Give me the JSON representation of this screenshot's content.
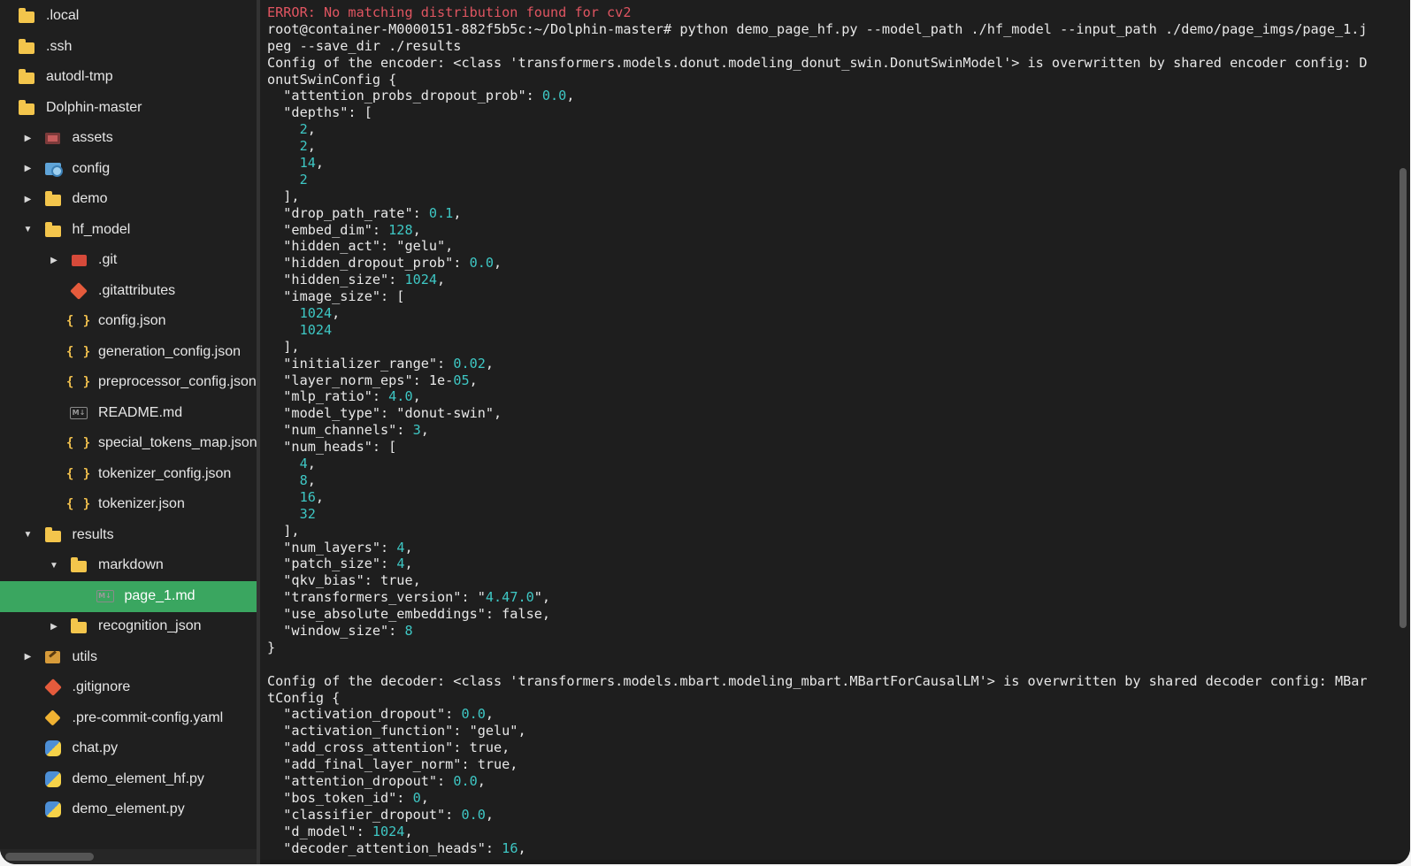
{
  "sidebar": {
    "items": [
      {
        "label": ".local",
        "icon": "folder-icon",
        "twisty": "none",
        "indent": 0
      },
      {
        "label": ".ssh",
        "icon": "folder-icon",
        "twisty": "none",
        "indent": 0
      },
      {
        "label": "autodl-tmp",
        "icon": "folder-icon",
        "twisty": "none",
        "indent": 0
      },
      {
        "label": "Dolphin-master",
        "icon": "folder-icon",
        "twisty": "none",
        "indent": 0
      },
      {
        "label": "assets",
        "icon": "assets-folder-icon",
        "twisty": "collapsed",
        "indent": 1
      },
      {
        "label": "config",
        "icon": "config-folder-icon",
        "twisty": "collapsed",
        "indent": 1
      },
      {
        "label": "demo",
        "icon": "folder-icon",
        "twisty": "collapsed",
        "indent": 1
      },
      {
        "label": "hf_model",
        "icon": "folder-icon",
        "twisty": "expanded",
        "indent": 1
      },
      {
        "label": ".git",
        "icon": "git-folder-icon",
        "twisty": "collapsed",
        "indent": 2
      },
      {
        "label": ".gitattributes",
        "icon": "git-icon",
        "twisty": "none",
        "indent": 2
      },
      {
        "label": "config.json",
        "icon": "json-icon",
        "twisty": "none",
        "indent": 2
      },
      {
        "label": "generation_config.json",
        "icon": "json-icon",
        "twisty": "none",
        "indent": 2
      },
      {
        "label": "preprocessor_config.json",
        "icon": "json-icon",
        "twisty": "none",
        "indent": 2
      },
      {
        "label": "README.md",
        "icon": "markdown-icon",
        "twisty": "none",
        "indent": 2
      },
      {
        "label": "special_tokens_map.json",
        "icon": "json-icon",
        "twisty": "none",
        "indent": 2
      },
      {
        "label": "tokenizer_config.json",
        "icon": "json-icon",
        "twisty": "none",
        "indent": 2
      },
      {
        "label": "tokenizer.json",
        "icon": "json-icon",
        "twisty": "none",
        "indent": 2
      },
      {
        "label": "results",
        "icon": "folder-icon",
        "twisty": "expanded",
        "indent": 1
      },
      {
        "label": "markdown",
        "icon": "folder-icon",
        "twisty": "expanded",
        "indent": 2
      },
      {
        "label": "page_1.md",
        "icon": "markdown-icon",
        "twisty": "none",
        "indent": 3,
        "selected": true
      },
      {
        "label": "recognition_json",
        "icon": "folder-icon",
        "twisty": "collapsed",
        "indent": 2
      },
      {
        "label": "utils",
        "icon": "utils-folder-icon",
        "twisty": "collapsed",
        "indent": 1
      },
      {
        "label": ".gitignore",
        "icon": "git-icon",
        "twisty": "none",
        "indent": 1
      },
      {
        "label": ".pre-commit-config.yaml",
        "icon": "yaml-icon",
        "twisty": "none",
        "indent": 1
      },
      {
        "label": "chat.py",
        "icon": "python-icon",
        "twisty": "none",
        "indent": 1
      },
      {
        "label": "demo_element_hf.py",
        "icon": "python-icon",
        "twisty": "none",
        "indent": 1
      },
      {
        "label": "demo_element.py",
        "icon": "python-icon",
        "twisty": "none",
        "indent": 1
      }
    ]
  },
  "terminal": {
    "lines": [
      [
        [
          "ERROR: No matching distribution found for cv2",
          "err"
        ]
      ],
      [
        [
          "root@container-M0000151-882f5b5c:~/Dolphin-master# python demo_page_hf.py --model_path ./hf_model --input_path ./demo/page_imgs/page_1.j",
          ""
        ]
      ],
      [
        [
          "peg --save_dir ./results",
          ""
        ]
      ],
      [
        [
          "Config of the encoder: <class 'transformers.models.donut.modeling_donut_swin.DonutSwinModel'> is overwritten by shared encoder config: D",
          ""
        ]
      ],
      [
        [
          "onutSwinConfig {",
          ""
        ]
      ],
      [
        [
          "  \"attention_probs_dropout_prob\": ",
          ""
        ],
        [
          "0.0",
          "num"
        ],
        [
          ",",
          ""
        ]
      ],
      [
        [
          "  \"depths\": [",
          ""
        ]
      ],
      [
        [
          "    ",
          ""
        ],
        [
          "2",
          "num"
        ],
        [
          ",",
          ""
        ]
      ],
      [
        [
          "    ",
          ""
        ],
        [
          "2",
          "num"
        ],
        [
          ",",
          ""
        ]
      ],
      [
        [
          "    ",
          ""
        ],
        [
          "14",
          "num"
        ],
        [
          ",",
          ""
        ]
      ],
      [
        [
          "    ",
          ""
        ],
        [
          "2",
          "num"
        ]
      ],
      [
        [
          "  ],",
          ""
        ]
      ],
      [
        [
          "  \"drop_path_rate\": ",
          ""
        ],
        [
          "0.1",
          "num"
        ],
        [
          ",",
          ""
        ]
      ],
      [
        [
          "  \"embed_dim\": ",
          ""
        ],
        [
          "128",
          "num"
        ],
        [
          ",",
          ""
        ]
      ],
      [
        [
          "  \"hidden_act\": \"gelu\",",
          ""
        ]
      ],
      [
        [
          "  \"hidden_dropout_prob\": ",
          ""
        ],
        [
          "0.0",
          "num"
        ],
        [
          ",",
          ""
        ]
      ],
      [
        [
          "  \"hidden_size\": ",
          ""
        ],
        [
          "1024",
          "num"
        ],
        [
          ",",
          ""
        ]
      ],
      [
        [
          "  \"image_size\": [",
          ""
        ]
      ],
      [
        [
          "    ",
          ""
        ],
        [
          "1024",
          "num"
        ],
        [
          ",",
          ""
        ]
      ],
      [
        [
          "    ",
          ""
        ],
        [
          "1024",
          "num"
        ]
      ],
      [
        [
          "  ],",
          ""
        ]
      ],
      [
        [
          "  \"initializer_range\": ",
          ""
        ],
        [
          "0.02",
          "num"
        ],
        [
          ",",
          ""
        ]
      ],
      [
        [
          "  \"layer_norm_eps\": 1e-",
          ""
        ],
        [
          "05",
          "num"
        ],
        [
          ",",
          ""
        ]
      ],
      [
        [
          "  \"mlp_ratio\": ",
          ""
        ],
        [
          "4.0",
          "num"
        ],
        [
          ",",
          ""
        ]
      ],
      [
        [
          "  \"model_type\": \"donut-swin\",",
          ""
        ]
      ],
      [
        [
          "  \"num_channels\": ",
          ""
        ],
        [
          "3",
          "num"
        ],
        [
          ",",
          ""
        ]
      ],
      [
        [
          "  \"num_heads\": [",
          ""
        ]
      ],
      [
        [
          "    ",
          ""
        ],
        [
          "4",
          "num"
        ],
        [
          ",",
          ""
        ]
      ],
      [
        [
          "    ",
          ""
        ],
        [
          "8",
          "num"
        ],
        [
          ",",
          ""
        ]
      ],
      [
        [
          "    ",
          ""
        ],
        [
          "16",
          "num"
        ],
        [
          ",",
          ""
        ]
      ],
      [
        [
          "    ",
          ""
        ],
        [
          "32",
          "num"
        ]
      ],
      [
        [
          "  ],",
          ""
        ]
      ],
      [
        [
          "  \"num_layers\": ",
          ""
        ],
        [
          "4",
          "num"
        ],
        [
          ",",
          ""
        ]
      ],
      [
        [
          "  \"patch_size\": ",
          ""
        ],
        [
          "4",
          "num"
        ],
        [
          ",",
          ""
        ]
      ],
      [
        [
          "  \"qkv_bias\": true,",
          ""
        ]
      ],
      [
        [
          "  \"transformers_version\": \"",
          ""
        ],
        [
          "4.47.0",
          "num"
        ],
        [
          "\",",
          ""
        ]
      ],
      [
        [
          "  \"use_absolute_embeddings\": false,",
          ""
        ]
      ],
      [
        [
          "  \"window_size\": ",
          ""
        ],
        [
          "8",
          "num"
        ]
      ],
      [
        [
          "}",
          ""
        ]
      ],
      [
        [
          "",
          ""
        ]
      ],
      [
        [
          "Config of the decoder: <class 'transformers.models.mbart.modeling_mbart.MBartForCausalLM'> is overwritten by shared decoder config: MBar",
          ""
        ]
      ],
      [
        [
          "tConfig {",
          ""
        ]
      ],
      [
        [
          "  \"activation_dropout\": ",
          ""
        ],
        [
          "0.0",
          "num"
        ],
        [
          ",",
          ""
        ]
      ],
      [
        [
          "  \"activation_function\": \"gelu\",",
          ""
        ]
      ],
      [
        [
          "  \"add_cross_attention\": true,",
          ""
        ]
      ],
      [
        [
          "  \"add_final_layer_norm\": true,",
          ""
        ]
      ],
      [
        [
          "  \"attention_dropout\": ",
          ""
        ],
        [
          "0.0",
          "num"
        ],
        [
          ",",
          ""
        ]
      ],
      [
        [
          "  \"bos_token_id\": ",
          ""
        ],
        [
          "0",
          "num"
        ],
        [
          ",",
          ""
        ]
      ],
      [
        [
          "  \"classifier_dropout\": ",
          ""
        ],
        [
          "0.0",
          "num"
        ],
        [
          ",",
          ""
        ]
      ],
      [
        [
          "  \"d_model\": ",
          ""
        ],
        [
          "1024",
          "num"
        ],
        [
          ",",
          ""
        ]
      ],
      [
        [
          "  \"decoder_attention_heads\": ",
          ""
        ],
        [
          "16",
          "num"
        ],
        [
          ",",
          ""
        ]
      ]
    ]
  }
}
